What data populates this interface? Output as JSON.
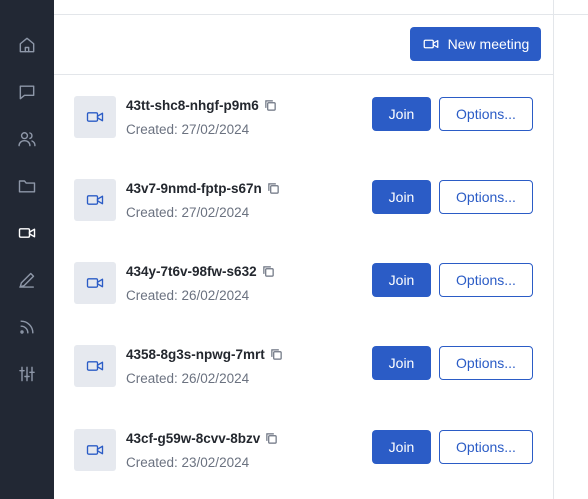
{
  "sidebar": {
    "items": [
      {
        "name": "home"
      },
      {
        "name": "messages"
      },
      {
        "name": "people"
      },
      {
        "name": "folder"
      },
      {
        "name": "video",
        "active": true
      },
      {
        "name": "edit"
      },
      {
        "name": "feed"
      },
      {
        "name": "settings"
      }
    ]
  },
  "header": {
    "new_meeting_label": "New meeting"
  },
  "meetings": [
    {
      "code": "43tt-shc8-nhgf-p9m6",
      "created": "Created: 27/02/2024",
      "join_label": "Join",
      "options_label": "Options..."
    },
    {
      "code": "43v7-9nmd-fptp-s67n",
      "created": "Created: 27/02/2024",
      "join_label": "Join",
      "options_label": "Options..."
    },
    {
      "code": "434y-7t6v-98fw-s632",
      "created": "Created: 26/02/2024",
      "join_label": "Join",
      "options_label": "Options..."
    },
    {
      "code": "4358-8g3s-npwg-7mrt",
      "created": "Created: 26/02/2024",
      "join_label": "Join",
      "options_label": "Options..."
    },
    {
      "code": "43cf-g59w-8cvv-8bzv",
      "created": "Created: 23/02/2024",
      "join_label": "Join",
      "options_label": "Options..."
    }
  ],
  "colors": {
    "sidebar_bg": "#222834",
    "accent": "#2b5cc6",
    "thumb_bg": "#e6e9ef"
  }
}
